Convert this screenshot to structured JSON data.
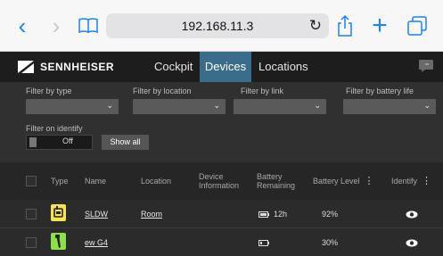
{
  "browser": {
    "url": "192.168.11.3"
  },
  "app": {
    "brand": "SENNHEISER",
    "nav": {
      "cockpit": "Cockpit",
      "devices": "Devices",
      "locations": "Locations"
    },
    "accent_color": "#3a6d8b"
  },
  "filters": {
    "type_label": "Filter by type",
    "location_label": "Filter by location",
    "link_label": "Filter by link",
    "battery_label": "Filter by battery life",
    "identify_label": "Filter on identify",
    "identify_toggle": "Off",
    "show_all": "Show all"
  },
  "table": {
    "headers": {
      "type": "Type",
      "name": "Name",
      "location": "Location",
      "device_info": "Device Information",
      "battery_remaining": "Battery Remaining",
      "battery_level": "Battery Level",
      "identify": "Identify"
    },
    "rows": [
      {
        "type_icon": "bodypack-transmitter-icon",
        "type_color": "#f5e44a",
        "name": "SLDW",
        "location": "Room",
        "battery_remaining": "12h",
        "battery_level": "92%"
      },
      {
        "type_icon": "handheld-microphone-icon",
        "type_color": "#8ee04a",
        "name": "ew G4",
        "location": "",
        "battery_remaining": "",
        "battery_level": "30%"
      }
    ]
  }
}
